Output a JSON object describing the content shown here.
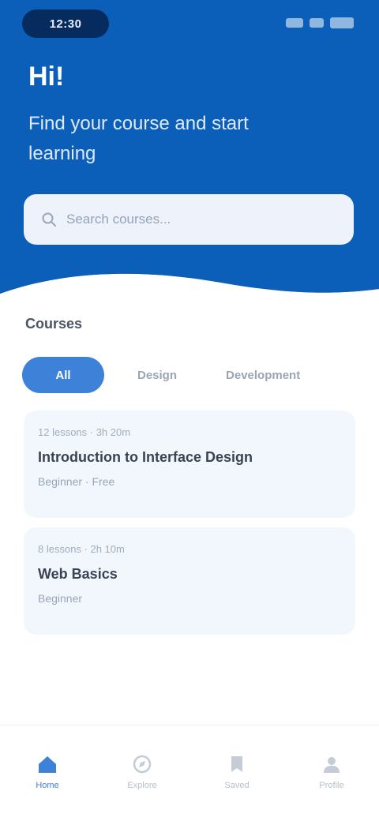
{
  "status_bar": {
    "time": "12:30"
  },
  "hero": {
    "greeting": "Hi!",
    "title": "Find your course and start learning"
  },
  "search": {
    "placeholder": "Search courses..."
  },
  "section": {
    "title": "Courses"
  },
  "tabs": [
    {
      "label": "All",
      "active": true
    },
    {
      "label": "Design",
      "active": false
    },
    {
      "label": "Development",
      "active": false
    }
  ],
  "cards": [
    {
      "meta": "12 lessons · 3h 20m",
      "title": "Introduction to Interface Design",
      "subtitle": "Beginner · Free"
    },
    {
      "meta": "8 lessons · 2h 10m",
      "title": "Web Basics",
      "subtitle": "Beginner"
    }
  ],
  "bottom_nav": [
    {
      "label": "Home",
      "icon": "home-icon",
      "active": true
    },
    {
      "label": "Explore",
      "icon": "compass-icon",
      "active": false
    },
    {
      "label": "Saved",
      "icon": "bookmark-icon",
      "active": false
    },
    {
      "label": "Profile",
      "icon": "user-icon",
      "active": false
    }
  ],
  "colors": {
    "hero_blue": "#0b5fb8",
    "accent": "#3d82d8",
    "card_bg": "#f1f7fd"
  }
}
